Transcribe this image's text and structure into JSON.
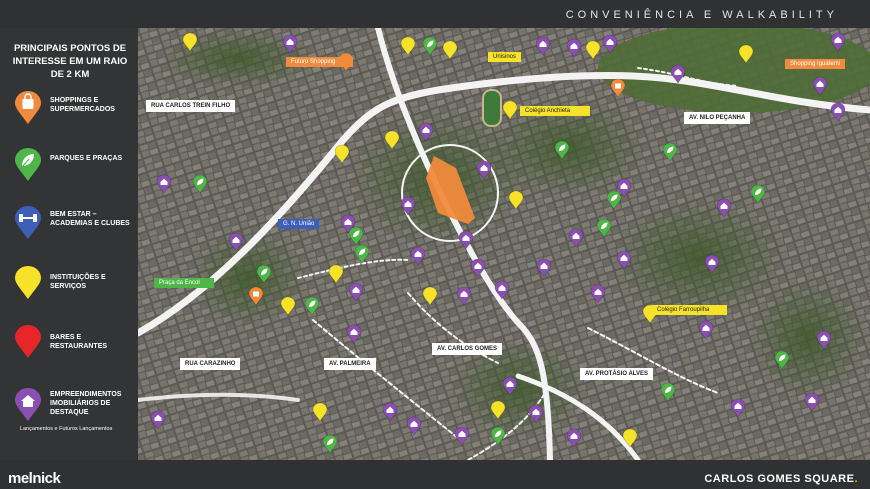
{
  "header": {
    "title": "CONVENIÊNCIA E WALKABILITY"
  },
  "brand": {
    "logo": "melnick",
    "project": "CARLOS GOMES SQUARE"
  },
  "legend": {
    "heading": "PRINCIPAIS PONTOS DE INTERESSE EM UM RAIO DE 2 KM",
    "items": [
      {
        "label": "SHOPPINGS E SUPERMERCADOS",
        "color": "#f08a3c",
        "icon": "shopping-bag-icon"
      },
      {
        "label": "PARQUES E PRAÇAS",
        "color": "#4fb548",
        "icon": "leaf-icon"
      },
      {
        "label": "BEM ESTAR – ACADEMIAS E CLUBES",
        "color": "#3d5fb8",
        "icon": "dumbbell-icon"
      },
      {
        "label": "INSTITUIÇÕES E SERVIÇOS",
        "color": "#f6e229",
        "icon": "building-icon"
      },
      {
        "label": "BARES E RESTAURANTES",
        "color": "#e8262a",
        "icon": "glass-icon"
      },
      {
        "label": "EMPREENDIMENTOS IMOBILIÁRIOS DE DESTAQUE",
        "color": "#8a4fb0",
        "icon": "house-icon",
        "sub": "Lançamentos e   Futuros Lançamentos"
      }
    ]
  },
  "map": {
    "streets": {
      "rua_carlos_trein_filho": "RUA CARLOS TREIN FILHO",
      "av_nilo_pecanha": "AV. NILO PEÇANHA",
      "rua_carazinho": "RUA CARAZINHO",
      "av_palmeira": "AV. PALMEIRA",
      "av_carlos_gomes": "AV. CARLOS GOMES",
      "av_protasio_alves": "AV. PROTÁSIO ALVES"
    },
    "places": {
      "iguatemi": "Shopping Iguatemi",
      "futuro": "Futuro Shopping",
      "unisinos": "Unisinos",
      "anchieta": "Colégio Anchieta",
      "gnu": "G. N. União",
      "encol": "Praça da Encol",
      "farroupilha": "Colégio Farroupilha"
    }
  }
}
